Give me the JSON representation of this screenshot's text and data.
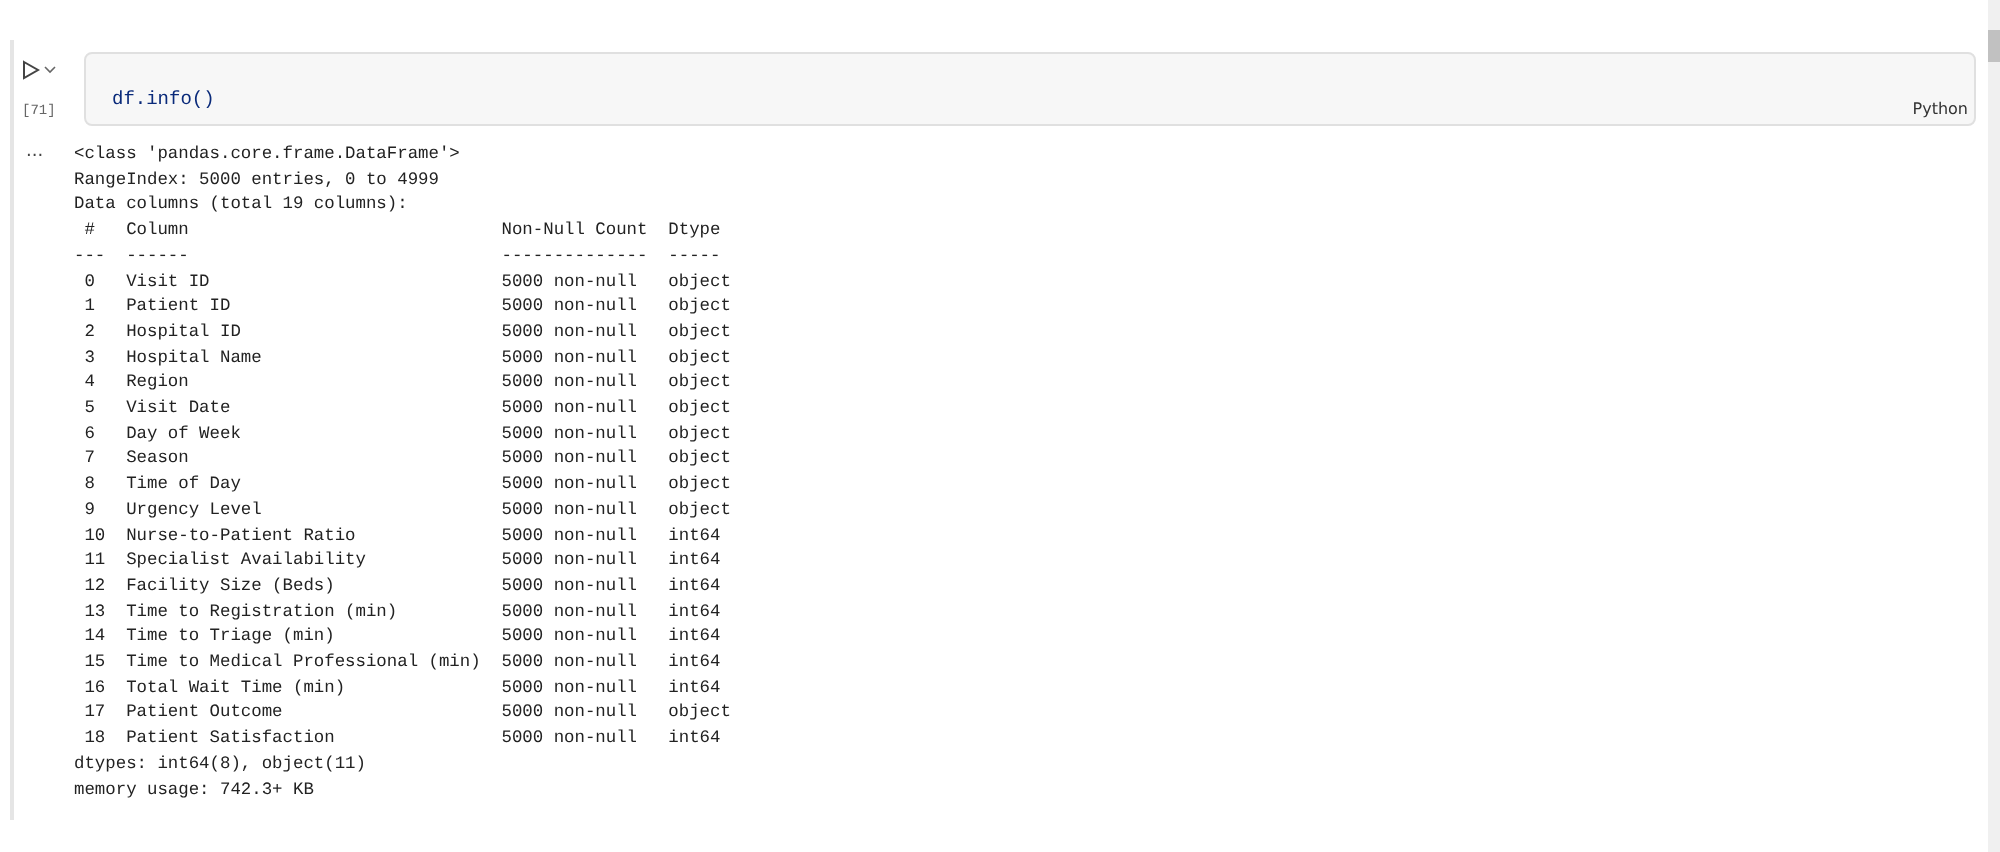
{
  "cell": {
    "execution_count": "[71]",
    "code": "df.info()",
    "language": "Python"
  },
  "output": {
    "prompt": "...",
    "lines": [
      "<class 'pandas.core.frame.DataFrame'>",
      "RangeIndex: 5000 entries, 0 to 4999",
      "Data columns (total 19 columns):",
      " #   Column                              Non-Null Count  Dtype",
      "---  ------                              --------------  -----",
      " 0   Visit ID                            5000 non-null   object",
      " 1   Patient ID                          5000 non-null   object",
      " 2   Hospital ID                         5000 non-null   object",
      " 3   Hospital Name                       5000 non-null   object",
      " 4   Region                              5000 non-null   object",
      " 5   Visit Date                          5000 non-null   object",
      " 6   Day of Week                         5000 non-null   object",
      " 7   Season                              5000 non-null   object",
      " 8   Time of Day                         5000 non-null   object",
      " 9   Urgency Level                       5000 non-null   object",
      " 10  Nurse-to-Patient Ratio              5000 non-null   int64",
      " 11  Specialist Availability             5000 non-null   int64",
      " 12  Facility Size (Beds)                5000 non-null   int64",
      " 13  Time to Registration (min)          5000 non-null   int64",
      " 14  Time to Triage (min)                5000 non-null   int64",
      " 15  Time to Medical Professional (min)  5000 non-null   int64",
      " 16  Total Wait Time (min)               5000 non-null   int64",
      " 17  Patient Outcome                     5000 non-null   object",
      " 18  Patient Satisfaction                5000 non-null   int64",
      "dtypes: int64(8), object(11)",
      "memory usage: 742.3+ KB"
    ]
  }
}
